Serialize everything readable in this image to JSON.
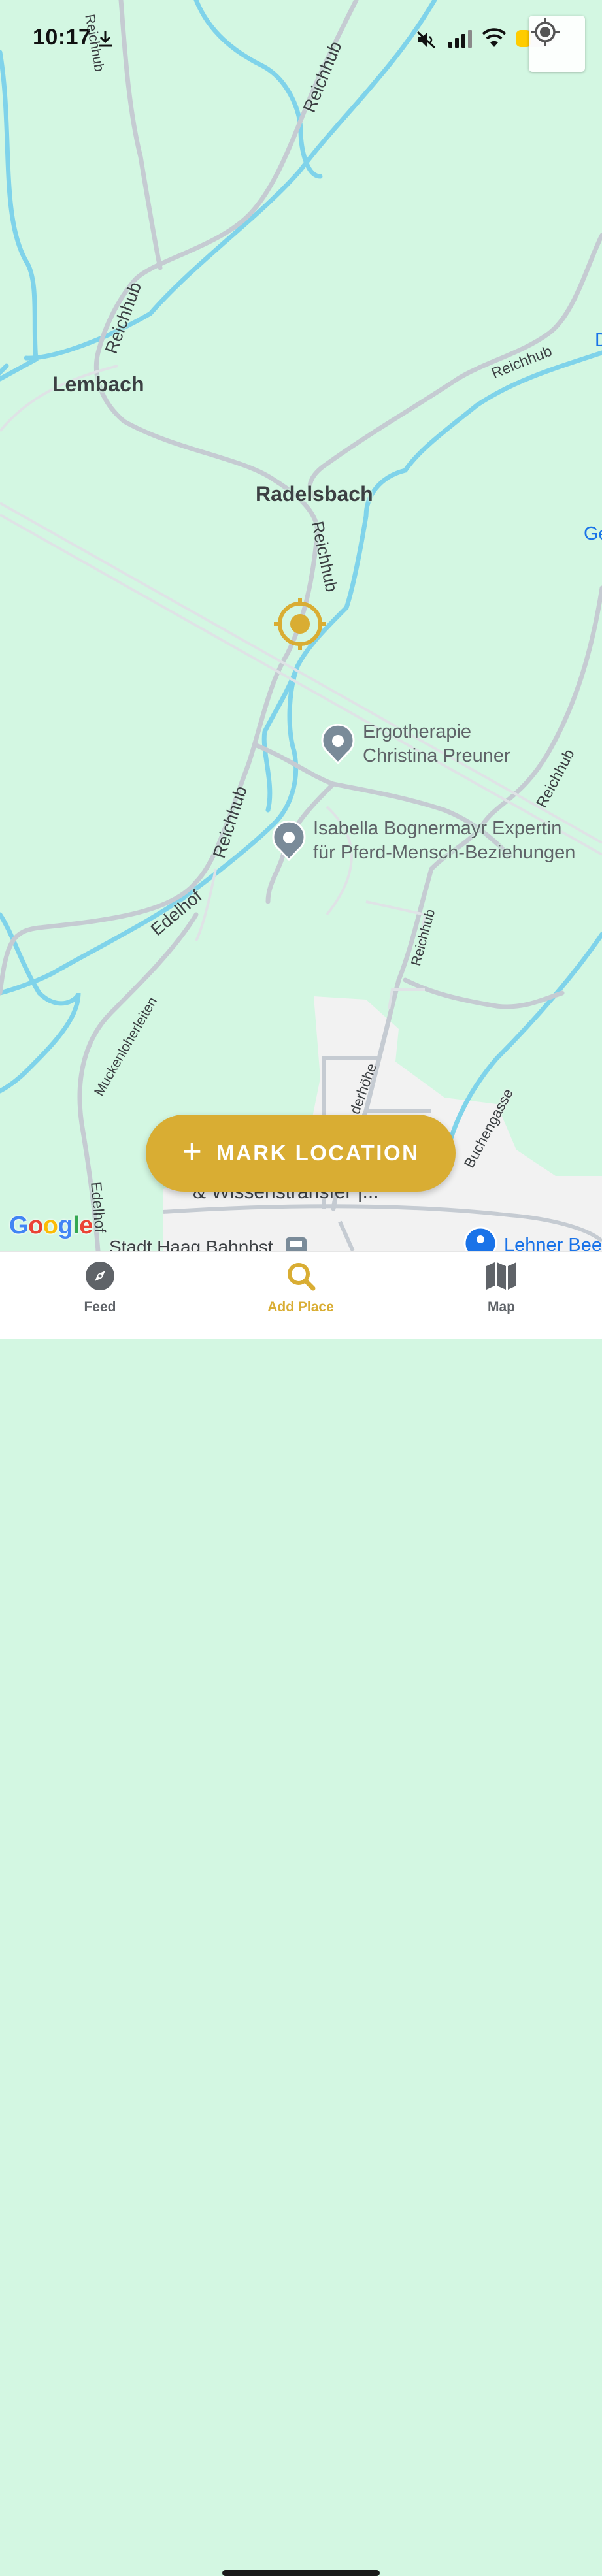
{
  "status_bar": {
    "time": "10:17",
    "icons": [
      "download-icon",
      "mute-icon",
      "signal-icon",
      "wifi-icon",
      "battery-icon"
    ]
  },
  "map": {
    "places": {
      "lembach": "Lembach",
      "radelsbach": "Radelsbach"
    },
    "roads": {
      "reichhub_1": "Reichhub",
      "reichhub_2": "Reichhub",
      "reichhub_3": "Reichhub",
      "reichhub_4": "Reichhub",
      "reichhub_5": "Reichhub",
      "reichhub_6": "Reichhub",
      "reichhub_7": "Reichhub",
      "edelhof_1": "Edelhof",
      "edelhof_2": "Edelhof",
      "muckenloherleiten": "Muckenloherleiten",
      "buchengasse": "Buchengasse",
      "derhohe": "derhöhe"
    },
    "pois": [
      {
        "line1": "Ergotherapie",
        "line2": "Christina Preuner"
      },
      {
        "line1": "Isabella Bognermayr Expertin",
        "line2": "für Pferd-Mensch-Beziehungen"
      }
    ],
    "partial_labels": {
      "wissenstransfer": "& Wissenstransfer |...",
      "stadt_haag": "Stadt Haag Bahnhst",
      "lehner": "Lehner Bee",
      "edge_d": "D",
      "edge_ge": "Ge"
    },
    "attribution": "Google",
    "colors": {
      "land": "#d3f7e2",
      "water": "#7fd3ea",
      "road": "#c5cbd2",
      "urban": "#f2f2f2",
      "accent": "#d9ad33"
    }
  },
  "actions": {
    "mark_location": "MARK LOCATION",
    "locate_me_icon": "crosshair-icon"
  },
  "tabs": [
    {
      "label": "Feed",
      "icon": "compass-icon",
      "active": false
    },
    {
      "label": "Add Place",
      "icon": "search-icon",
      "active": true
    },
    {
      "label": "Map",
      "icon": "map-icon",
      "active": false
    }
  ]
}
